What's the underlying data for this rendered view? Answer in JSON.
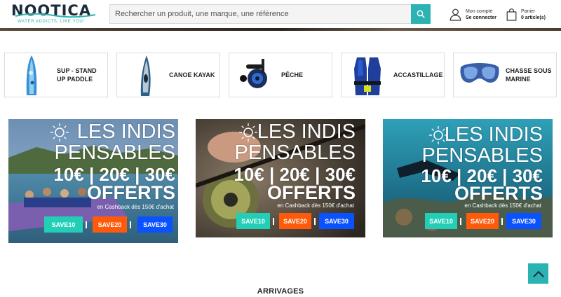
{
  "header": {
    "logo_text": "NOOTICA",
    "logo_tagline": "WATER ADDICTS, LIKE YOU!",
    "search_placeholder": "Rechercher un produit, une marque, une référence",
    "account_line1": "Mon compte",
    "account_line2": "Se connecter",
    "cart_line1": "Panier",
    "cart_line2": "0 article(s)",
    "accent_color": "#2bb3b3"
  },
  "categories": [
    {
      "label": "SUP - STAND UP PADDLE",
      "icon": "paddle-board-image"
    },
    {
      "label": "CANOE KAYAK",
      "icon": "kayak-image"
    },
    {
      "label": "PÊCHE",
      "icon": "fishing-reel-image"
    },
    {
      "label": "ACCASTILLAGE",
      "icon": "life-jacket-image"
    },
    {
      "label": "CHASSE SOUS MARINE",
      "icon": "diving-mask-image"
    }
  ],
  "promo": {
    "line1": "LES INDIS",
    "line2": "PENSABLES",
    "line3": "10€ | 20€ | 30€",
    "line4": "OFFERTS",
    "note": "en Cashback dès 150€ d'achat",
    "codes": [
      "SAVE10",
      "SAVE20",
      "SAVE30"
    ],
    "code_colors": [
      "#22cfb6",
      "#ff5a0a",
      "#0a52ff"
    ]
  },
  "section_title": "ARRIVAGES"
}
